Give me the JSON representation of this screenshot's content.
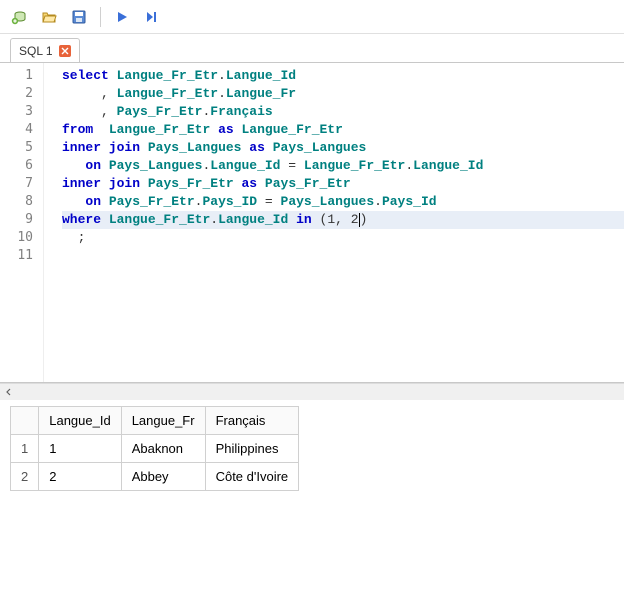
{
  "toolbar": {
    "icons": [
      "connect-icon",
      "open-icon",
      "save-icon",
      "run-icon",
      "run-to-end-icon"
    ]
  },
  "tabs": {
    "active": {
      "label": "SQL 1"
    }
  },
  "editor": {
    "line_count": 11,
    "tokens": [
      [
        [
          "kw",
          "select"
        ],
        [
          "sp",
          " "
        ],
        [
          "id",
          "Langue_Fr_Etr"
        ],
        [
          "pn",
          "."
        ],
        [
          "id",
          "Langue_Id"
        ]
      ],
      [
        [
          "sp",
          "     "
        ],
        [
          "pn",
          ","
        ],
        [
          "sp",
          " "
        ],
        [
          "id",
          "Langue_Fr_Etr"
        ],
        [
          "pn",
          "."
        ],
        [
          "id",
          "Langue_Fr"
        ]
      ],
      [
        [
          "sp",
          "     "
        ],
        [
          "pn",
          ","
        ],
        [
          "sp",
          " "
        ],
        [
          "id",
          "Pays_Fr_Etr"
        ],
        [
          "pn",
          "."
        ],
        [
          "id",
          "Français"
        ]
      ],
      [
        [
          "kw",
          "from"
        ],
        [
          "sp",
          "  "
        ],
        [
          "id",
          "Langue_Fr_Etr"
        ],
        [
          "sp",
          " "
        ],
        [
          "kw",
          "as"
        ],
        [
          "sp",
          " "
        ],
        [
          "id",
          "Langue_Fr_Etr"
        ]
      ],
      [
        [
          "kw",
          "inner"
        ],
        [
          "sp",
          " "
        ],
        [
          "kw",
          "join"
        ],
        [
          "sp",
          " "
        ],
        [
          "id",
          "Pays_Langues"
        ],
        [
          "sp",
          " "
        ],
        [
          "kw",
          "as"
        ],
        [
          "sp",
          " "
        ],
        [
          "id",
          "Pays_Langues"
        ]
      ],
      [
        [
          "sp",
          "   "
        ],
        [
          "kw",
          "on"
        ],
        [
          "sp",
          " "
        ],
        [
          "id",
          "Pays_Langues"
        ],
        [
          "pn",
          "."
        ],
        [
          "id",
          "Langue_Id"
        ],
        [
          "sp",
          " "
        ],
        [
          "op",
          "="
        ],
        [
          "sp",
          " "
        ],
        [
          "id",
          "Langue_Fr_Etr"
        ],
        [
          "pn",
          "."
        ],
        [
          "id",
          "Langue_Id"
        ]
      ],
      [
        [
          "kw",
          "inner"
        ],
        [
          "sp",
          " "
        ],
        [
          "kw",
          "join"
        ],
        [
          "sp",
          " "
        ],
        [
          "id",
          "Pays_Fr_Etr"
        ],
        [
          "sp",
          " "
        ],
        [
          "kw",
          "as"
        ],
        [
          "sp",
          " "
        ],
        [
          "id",
          "Pays_Fr_Etr"
        ]
      ],
      [
        [
          "sp",
          "   "
        ],
        [
          "kw",
          "on"
        ],
        [
          "sp",
          " "
        ],
        [
          "id",
          "Pays_Fr_Etr"
        ],
        [
          "pn",
          "."
        ],
        [
          "id",
          "Pays_ID"
        ],
        [
          "sp",
          " "
        ],
        [
          "op",
          "="
        ],
        [
          "sp",
          " "
        ],
        [
          "id",
          "Pays_Langues"
        ],
        [
          "pn",
          "."
        ],
        [
          "id",
          "Pays_Id"
        ]
      ],
      [
        [
          "kw",
          "where"
        ],
        [
          "sp",
          " "
        ],
        [
          "id",
          "Langue_Fr_Etr"
        ],
        [
          "pn",
          "."
        ],
        [
          "id",
          "Langue_Id"
        ],
        [
          "sp",
          " "
        ],
        [
          "kw",
          "in"
        ],
        [
          "sp",
          " "
        ],
        [
          "pn",
          "("
        ],
        [
          "num",
          "1"
        ],
        [
          "pn",
          ","
        ],
        [
          "sp",
          " "
        ],
        [
          "num",
          "2"
        ],
        [
          "caret",
          ""
        ],
        [
          "pn",
          ")"
        ]
      ],
      [
        [
          "sp",
          "  "
        ],
        [
          "pn",
          ";"
        ]
      ],
      []
    ],
    "highlight_line": 9
  },
  "results": {
    "columns": [
      "Langue_Id",
      "Langue_Fr",
      "Français"
    ],
    "rows": [
      {
        "n": "1",
        "cells": [
          "1",
          "Abaknon",
          "Philippines"
        ]
      },
      {
        "n": "2",
        "cells": [
          "2",
          "Abbey",
          "Côte d'Ivoire"
        ]
      }
    ]
  }
}
